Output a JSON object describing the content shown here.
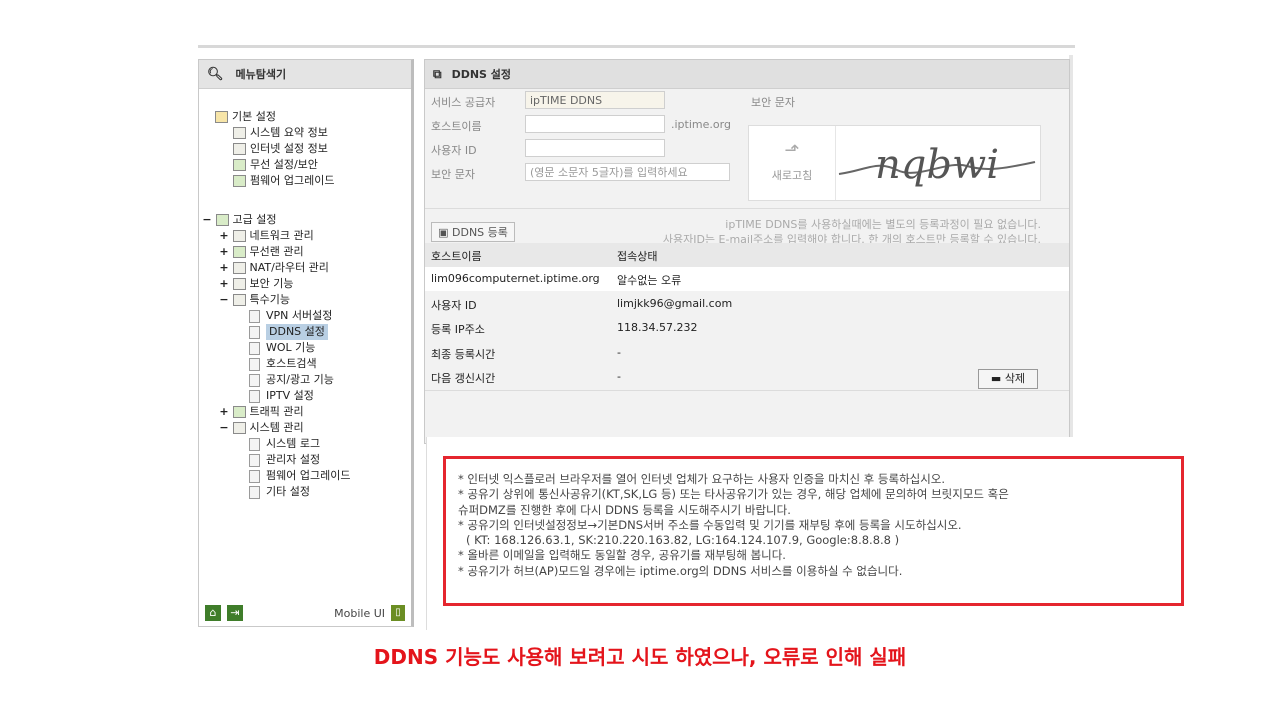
{
  "sidebar": {
    "title": "메뉴탐색기",
    "basic_group": "기본 설정",
    "basic_items": [
      "시스템 요약 정보",
      "인터넷 설정 정보",
      "무선 설정/보안",
      "펌웨어 업그레이드"
    ],
    "advanced_group": "고급 설정",
    "advanced_items": {
      "network": "네트워크 관리",
      "wireless": "무선랜 관리",
      "nat": "NAT/라우터 관리",
      "security": "보안 기능",
      "special": "특수기능",
      "special_children": [
        "VPN 서버설정",
        "DDNS 설정",
        "WOL 기능",
        "호스트검색",
        "공지/광고 기능",
        "IPTV 설정"
      ],
      "traffic": "트래픽 관리",
      "system": "시스템 관리",
      "system_children": [
        "시스템 로그",
        "관리자 설정",
        "펌웨어 업그레이드",
        "기타 설정"
      ]
    },
    "mobile_label": "Mobile UI"
  },
  "main": {
    "title": "DDNS 설정",
    "labels": {
      "provider": "서비스 공급자",
      "hostname": "호스트이름",
      "userid": "사용자 ID",
      "security_text": "보안 문자",
      "security_header": "보안 문자"
    },
    "provider_value": "ipTIME DDNS",
    "hostname_suffix": ".iptime.org",
    "security_placeholder": "(영문 소문자 5글자)를 입력하세요",
    "refresh_label": "새로고침",
    "captcha_text": "nqbwi",
    "register_button": "DDNS 등록",
    "info_line1": "ipTIME DDNS를 사용하실때에는 별도의 등록과정이 필요 없습니다.",
    "info_line2": "사용자ID는 E-mail주소를 입력해야 합니다. 한 개의 호스트만 등록할 수 있습니다.",
    "table": {
      "col_host": "호스트이름",
      "col_status": "접속상태",
      "host": "lim096computernet.iptime.org",
      "status": "알수없는 오류"
    },
    "details": {
      "userid_label": "사용자 ID",
      "userid_value": "limjkk96@gmail.com",
      "ip_label": "등록 IP주소",
      "ip_value": "118.34.57.232",
      "last_label": "최종 등록시간",
      "last_value": "-",
      "next_label": "다음 갱신시간",
      "next_value": "-"
    },
    "delete_button": "삭제"
  },
  "notes": [
    "* 인터넷 익스플로러 브라우저를 열어 인터넷 업체가 요구하는 사용자 인증을 마치신 후 등록하십시오.",
    "* 공유기 상위에 통신사공유기(KT,SK,LG 등) 또는 타사공유기가 있는 경우, 해당 업체에 문의하여 브릿지모드 혹은",
    "슈퍼DMZ를 진행한 후에 다시 DDNS 등록을 시도해주시기 바랍니다.",
    "* 공유기의 인터넷설정정보→기본DNS서버 주소를 수동입력 및 기기를 재부팅 후에 등록을 시도하십시오.",
    "( KT: 168.126.63.1, SK:210.220.163.82, LG:164.124.107.9, Google:8.8.8.8 )",
    "* 올바른 이메일을 입력해도 동일할 경우, 공유기를 재부팅해 봅니다.",
    "* 공유기가 허브(AP)모드일 경우에는 iptime.org의 DDNS 서비스를 이용하실 수 없습니다."
  ],
  "caption": "DDNS 기능도 사용해 보려고 시도 하였으나, 오류로 인해 실패",
  "colors": {
    "caption": "#e4141b",
    "highlight_border": "#e5262f",
    "selected_item": "#b9cfe3"
  }
}
